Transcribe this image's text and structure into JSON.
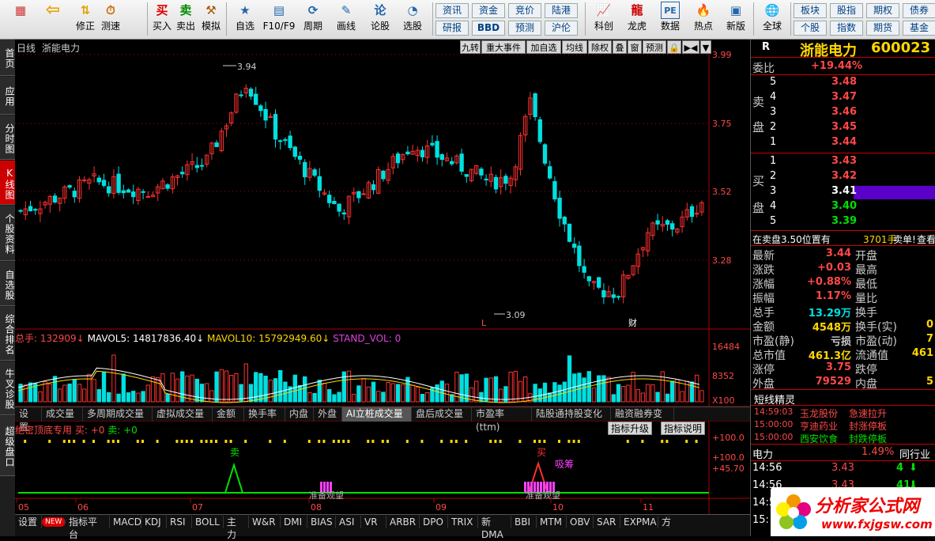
{
  "toolbar": {
    "buttons": [
      {
        "label": "",
        "icon": "app-grid-icon",
        "ch": "▦"
      },
      {
        "label": "",
        "icon": "back-arrow-icon",
        "ch": "⇦"
      },
      {
        "label": "修正",
        "icon": "up-down-icon",
        "ch": "⇅"
      },
      {
        "label": "测速",
        "icon": "clock-icon",
        "ch": "⏱"
      },
      {
        "label": "买入",
        "icon": "buy-icon",
        "ch": "买"
      },
      {
        "label": "卖出",
        "icon": "sell-icon",
        "ch": "卖"
      },
      {
        "label": "模拟",
        "icon": "hammer-icon",
        "ch": "⚒"
      },
      {
        "label": "自选",
        "icon": "star-folder-icon",
        "ch": "★"
      },
      {
        "label": "F10/F9",
        "icon": "doc-icon",
        "ch": "▤"
      },
      {
        "label": "周期",
        "icon": "cycle-icon",
        "ch": "⟳"
      },
      {
        "label": "画线",
        "icon": "pencil-icon",
        "ch": "✎"
      },
      {
        "label": "论股",
        "icon": "chat-icon",
        "ch": "论"
      },
      {
        "label": "选股",
        "icon": "search-chart-icon",
        "ch": "◔"
      }
    ],
    "small": [
      "资讯",
      "资金",
      "竞价",
      "陆港",
      "研报",
      "BBD",
      "预测",
      "沪伦"
    ],
    "big": [
      {
        "label": "科创",
        "icon": "chart-icon"
      },
      {
        "label": "龙虎",
        "icon": "dragon-icon"
      },
      {
        "label": "数据",
        "icon": "pe-icon"
      },
      {
        "label": "热点",
        "icon": "hot-icon"
      },
      {
        "label": "新版",
        "icon": "new-icon"
      },
      {
        "label": "全球",
        "icon": "globe-icon"
      }
    ],
    "small2": [
      "板块",
      "股指",
      "期权",
      "债券",
      "个股",
      "指数",
      "期货",
      "基金"
    ]
  },
  "sidebar": [
    "首页",
    "应用",
    "分时图",
    "K线图",
    "个股资料",
    "自选股",
    "综合排名",
    "牛叉诊股",
    "超级盘口"
  ],
  "chart": {
    "period": "日线",
    "name": "浙能电力",
    "top_tags": [
      "九转",
      "重大事件",
      "加自选",
      "均线",
      "除权",
      "叠",
      "窗",
      "预测",
      "🔒",
      "▶◀",
      "▼"
    ],
    "price_labels": [
      "3.99",
      "3.75",
      "3.52",
      "3.28"
    ],
    "high_label": "3.94",
    "low_label": "3.09",
    "marker_L": "L",
    "marker_cai": "财",
    "vol_line": {
      "total": "总手: 132909",
      "mavol5": "MAVOL5: 14817836.40",
      "mavol10": "MAVOL10: 15792949.60",
      "stand": "STAND_VOL: 0"
    },
    "vol_labels": [
      "16484",
      "8352",
      "X100"
    ],
    "tabs": [
      "设置",
      "成交量",
      "多周期成交量",
      "虚拟成交量",
      "金额",
      "换手率",
      "内盘",
      "外盘",
      "AI立桩成交量",
      "盘后成交量",
      "市盈率(ttm)",
      "陆股通持股变化",
      "融资融券变化"
    ],
    "active_tab": "AI立桩成交量",
    "ind_title": "绝密顶底专用",
    "ind_buy": "买: +0",
    "ind_sell": "卖: +0",
    "ind_btns": [
      "指标升级",
      "指标说明"
    ],
    "ind_labels": [
      "+100.0",
      "+100.0",
      "+45.70"
    ],
    "sig_sell": "卖",
    "sig_buy": "买",
    "sig_absorb": "吸筹",
    "sig_wait": [
      "准备观望",
      "准备观望"
    ],
    "x_labels": [
      "05",
      "06",
      "07",
      "08",
      "09",
      "10",
      "11"
    ]
  },
  "bottom": [
    "设置",
    "NEW",
    "指标平台",
    "MACD",
    "KDJ",
    "RSI",
    "BOLL",
    "主力",
    "W&R",
    "DMI",
    "BIAS",
    "ASI",
    "VR",
    "ARBR",
    "DPO",
    "TRIX",
    "新DMA",
    "BBI",
    "MTM",
    "OBV",
    "SAR",
    "EXPMA",
    "方"
  ],
  "right": {
    "r": "R",
    "name": "浙能电力",
    "code": "600023",
    "weibi_label": "委比",
    "weibi": "+19.44%",
    "sell_label": [
      "卖",
      "盘"
    ],
    "buy_label": [
      "买",
      "盘"
    ],
    "sells": [
      [
        "5",
        "3.48"
      ],
      [
        "4",
        "3.47"
      ],
      [
        "3",
        "3.46"
      ],
      [
        "2",
        "3.45"
      ],
      [
        "1",
        "3.44"
      ]
    ],
    "buys": [
      [
        "1",
        "3.43"
      ],
      [
        "2",
        "3.42"
      ],
      [
        "3",
        "3.41"
      ],
      [
        "4",
        "3.40"
      ],
      [
        "5",
        "3.39"
      ]
    ],
    "notice": "在卖盘3.50位置有",
    "notice_vol": "3701手",
    "notice_tail": "卖单!",
    "notice_link": "查看",
    "stats": [
      [
        "最新",
        "3.44",
        "开盘"
      ],
      [
        "涨跌",
        "+0.03",
        "最高"
      ],
      [
        "涨幅",
        "+0.88%",
        "最低"
      ],
      [
        "振幅",
        "1.17%",
        "量比"
      ],
      [
        "总手",
        "13.29万",
        "换手"
      ],
      [
        "金额",
        "4548万",
        "换手(实)"
      ],
      [
        "市盈(静)",
        "亏损",
        "市盈(动)"
      ],
      [
        "总市值",
        "461.3亿",
        "流通值"
      ],
      [
        "涨停",
        "3.75",
        "跌停"
      ],
      [
        "外盘",
        "79529",
        "内盘"
      ]
    ],
    "stats_right": [
      "",
      "",
      "",
      "",
      "",
      "0",
      "7",
      "461",
      "",
      "5"
    ],
    "short_title": "短线精灵",
    "short": [
      [
        "14:59:03",
        "玉龙股份",
        "急速拉升"
      ],
      [
        "15:00:00",
        "亨迪药业",
        "封涨停板"
      ],
      [
        "15:00:00",
        "西安饮食",
        "封跌停板"
      ]
    ],
    "sector": "电力",
    "sector_pct": "1.49%",
    "sector_tab": "同行业",
    "ticks": [
      [
        "14:56",
        "3.43",
        "4"
      ],
      [
        "14:56",
        "3.43",
        "41"
      ],
      [
        "14:56",
        "",
        ""
      ],
      [
        "15:",
        "",
        ""
      ]
    ]
  },
  "logo": {
    "cn": "分析家公式网",
    "url": "www.fxjgsw.com"
  },
  "colors": {
    "up": "#ff3030",
    "down": "#00e0e0",
    "green": "#00e000",
    "yellow": "#ffd700"
  }
}
